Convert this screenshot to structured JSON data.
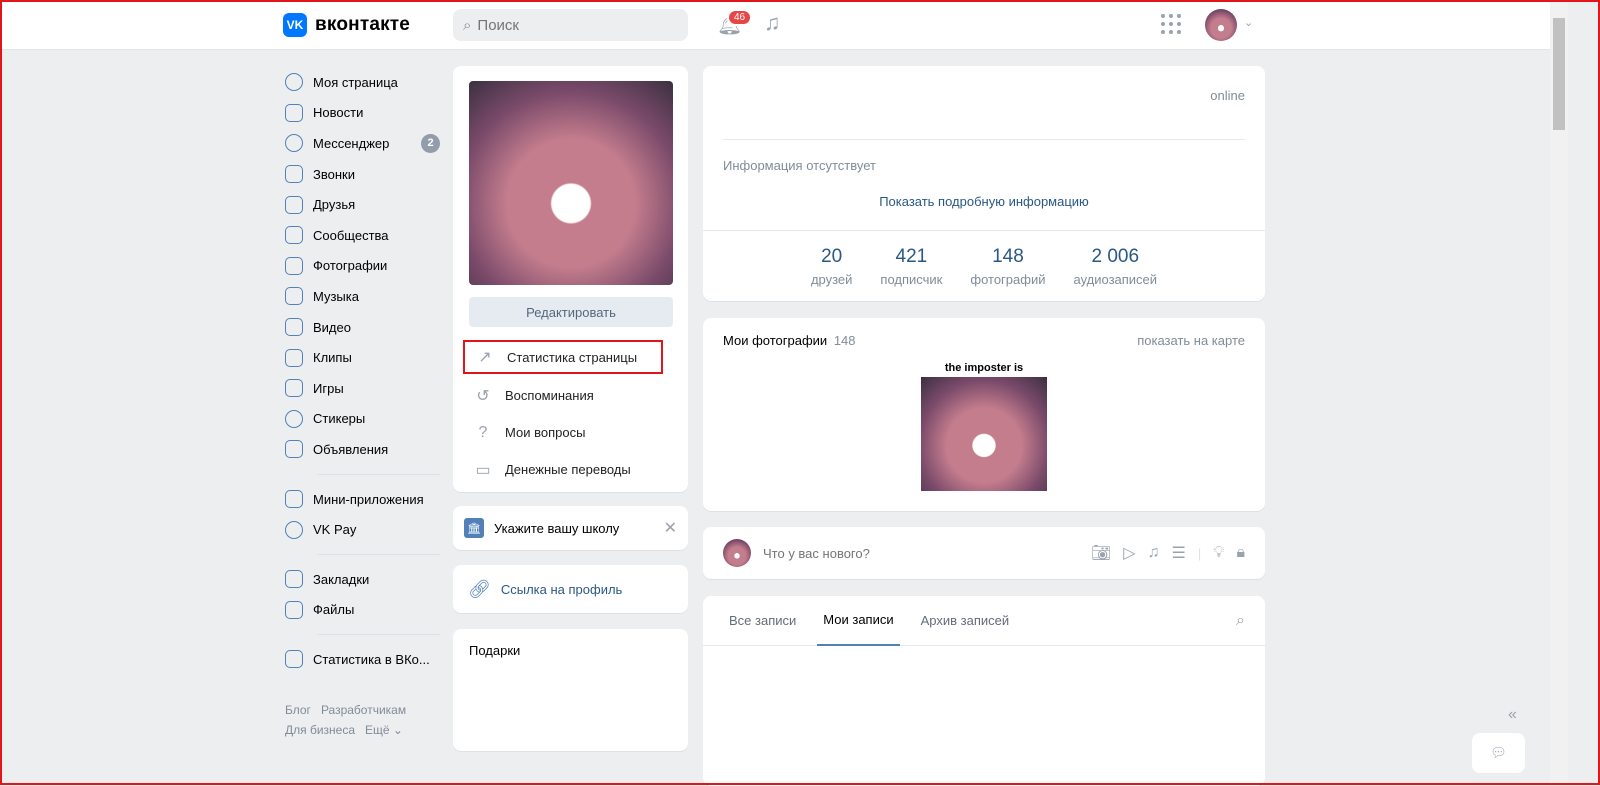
{
  "header": {
    "logo_text": "вконтакте",
    "logo_mark": "VK",
    "search_placeholder": "Поиск",
    "notifications_count": "46"
  },
  "nav": {
    "items": [
      {
        "label": "Моя страница"
      },
      {
        "label": "Новости"
      },
      {
        "label": "Мессенджер",
        "count": "2"
      },
      {
        "label": "Звонки"
      },
      {
        "label": "Друзья"
      },
      {
        "label": "Сообщества"
      },
      {
        "label": "Фотографии"
      },
      {
        "label": "Музыка"
      },
      {
        "label": "Видео"
      },
      {
        "label": "Клипы"
      },
      {
        "label": "Игры"
      },
      {
        "label": "Стикеры"
      },
      {
        "label": "Объявления"
      }
    ],
    "items2": [
      {
        "label": "Мини-приложения"
      },
      {
        "label": "VK Pay"
      }
    ],
    "items3": [
      {
        "label": "Закладки"
      },
      {
        "label": "Файлы"
      }
    ],
    "items4": [
      {
        "label": "Статистика в ВКо..."
      }
    ],
    "footer": [
      "Блог",
      "Разработчикам",
      "Для бизнеса",
      "Ещё ⌄"
    ]
  },
  "profile": {
    "edit_label": "Редактировать",
    "menu": [
      "Статистика страницы",
      "Воспоминания",
      "Мои вопросы",
      "Денежные переводы"
    ],
    "school": "Укажите вашу школу",
    "profile_link": "Ссылка на профиль",
    "gifts": "Подарки"
  },
  "info": {
    "status": "online",
    "no_info": "Информация отсутствует",
    "show_more": "Показать подробную информацию",
    "counters": [
      {
        "n": "20",
        "l": "друзей"
      },
      {
        "n": "421",
        "l": "подписчик"
      },
      {
        "n": "148",
        "l": "фотографий"
      },
      {
        "n": "2 006",
        "l": "аудиозаписей"
      }
    ]
  },
  "photos": {
    "title": "Мои фотографии",
    "count": "148",
    "map": "показать на карте",
    "caption": "the imposter is"
  },
  "composer": {
    "placeholder": "Что у вас нового?"
  },
  "wall": {
    "tabs": [
      "Все записи",
      "Мои записи",
      "Архив записей"
    ]
  }
}
